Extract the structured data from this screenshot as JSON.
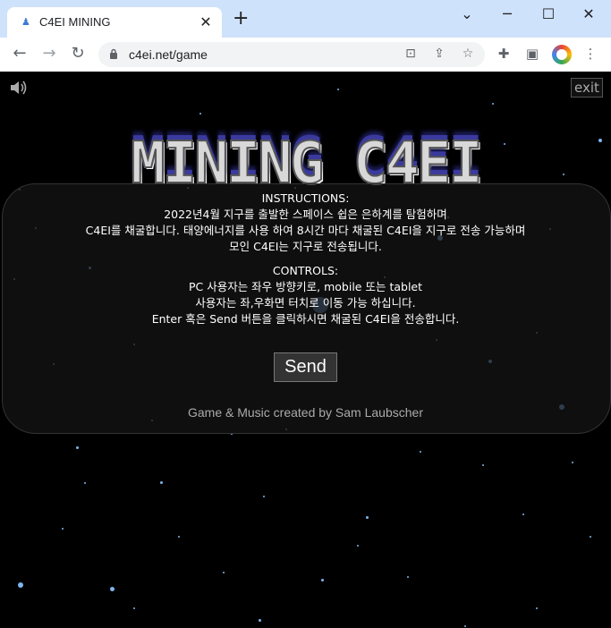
{
  "browser": {
    "tab_title": "C4EI MINING",
    "tab_close": "✕",
    "new_tab": "+",
    "url": "c4ei.net/game",
    "window_minimize": "─",
    "window_maximize": "☐",
    "window_close": "✕"
  },
  "game": {
    "logo": "MINING C4EI",
    "exit_label": "exit",
    "instructions_heading": "INSTRUCTIONS:",
    "instructions_lines": [
      "2022년4월 지구를 출발한 스페이스 쉽은 은하계를 탐험하며",
      "C4EI를 채굴합니다. 태양에너지를 사용 하여 8시간 마다 채굴된 C4EI을 지구로 전송 가능하며",
      "모인 C4EI는 지구로 전송됩니다."
    ],
    "controls_heading": "CONTROLS:",
    "controls_lines": [
      "PC 사용자는 좌우 방향키로, mobile 또는 tablet",
      "사용자는 좌,우화면 터치로 이동 가능 하십니다.",
      "Enter 혹은 Send 버튼을 클릭하시면 채굴된 C4EI을 전송합니다."
    ],
    "send_button": "Send",
    "credit": "Game & Music created by Sam Laubscher"
  },
  "colors": {
    "star": "#7fb6ef",
    "tabstrip": "#cfe2fb"
  },
  "icons": [
    "favicon-icon",
    "close-icon",
    "plus-icon",
    "chevron-down-icon",
    "back-icon",
    "forward-icon",
    "reload-icon",
    "lock-icon",
    "translate-icon",
    "share-icon",
    "star-icon",
    "extensions-icon",
    "sidepanel-icon",
    "profile-icon",
    "menu-icon",
    "speaker-icon"
  ]
}
